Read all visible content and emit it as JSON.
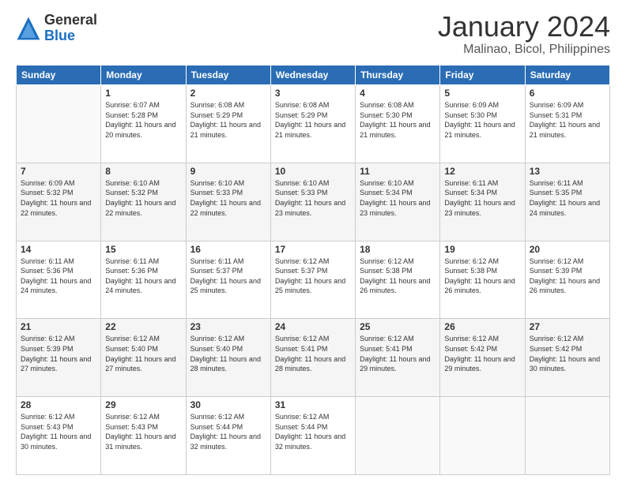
{
  "header": {
    "logo_general": "General",
    "logo_blue": "Blue",
    "month_title": "January 2024",
    "location": "Malinao, Bicol, Philippines"
  },
  "weekdays": [
    "Sunday",
    "Monday",
    "Tuesday",
    "Wednesday",
    "Thursday",
    "Friday",
    "Saturday"
  ],
  "weeks": [
    [
      {
        "day": "",
        "sunrise": "",
        "sunset": "",
        "daylight": ""
      },
      {
        "day": "1",
        "sunrise": "Sunrise: 6:07 AM",
        "sunset": "Sunset: 5:28 PM",
        "daylight": "Daylight: 11 hours and 20 minutes."
      },
      {
        "day": "2",
        "sunrise": "Sunrise: 6:08 AM",
        "sunset": "Sunset: 5:29 PM",
        "daylight": "Daylight: 11 hours and 21 minutes."
      },
      {
        "day": "3",
        "sunrise": "Sunrise: 6:08 AM",
        "sunset": "Sunset: 5:29 PM",
        "daylight": "Daylight: 11 hours and 21 minutes."
      },
      {
        "day": "4",
        "sunrise": "Sunrise: 6:08 AM",
        "sunset": "Sunset: 5:30 PM",
        "daylight": "Daylight: 11 hours and 21 minutes."
      },
      {
        "day": "5",
        "sunrise": "Sunrise: 6:09 AM",
        "sunset": "Sunset: 5:30 PM",
        "daylight": "Daylight: 11 hours and 21 minutes."
      },
      {
        "day": "6",
        "sunrise": "Sunrise: 6:09 AM",
        "sunset": "Sunset: 5:31 PM",
        "daylight": "Daylight: 11 hours and 21 minutes."
      }
    ],
    [
      {
        "day": "7",
        "sunrise": "Sunrise: 6:09 AM",
        "sunset": "Sunset: 5:32 PM",
        "daylight": "Daylight: 11 hours and 22 minutes."
      },
      {
        "day": "8",
        "sunrise": "Sunrise: 6:10 AM",
        "sunset": "Sunset: 5:32 PM",
        "daylight": "Daylight: 11 hours and 22 minutes."
      },
      {
        "day": "9",
        "sunrise": "Sunrise: 6:10 AM",
        "sunset": "Sunset: 5:33 PM",
        "daylight": "Daylight: 11 hours and 22 minutes."
      },
      {
        "day": "10",
        "sunrise": "Sunrise: 6:10 AM",
        "sunset": "Sunset: 5:33 PM",
        "daylight": "Daylight: 11 hours and 23 minutes."
      },
      {
        "day": "11",
        "sunrise": "Sunrise: 6:10 AM",
        "sunset": "Sunset: 5:34 PM",
        "daylight": "Daylight: 11 hours and 23 minutes."
      },
      {
        "day": "12",
        "sunrise": "Sunrise: 6:11 AM",
        "sunset": "Sunset: 5:34 PM",
        "daylight": "Daylight: 11 hours and 23 minutes."
      },
      {
        "day": "13",
        "sunrise": "Sunrise: 6:11 AM",
        "sunset": "Sunset: 5:35 PM",
        "daylight": "Daylight: 11 hours and 24 minutes."
      }
    ],
    [
      {
        "day": "14",
        "sunrise": "Sunrise: 6:11 AM",
        "sunset": "Sunset: 5:36 PM",
        "daylight": "Daylight: 11 hours and 24 minutes."
      },
      {
        "day": "15",
        "sunrise": "Sunrise: 6:11 AM",
        "sunset": "Sunset: 5:36 PM",
        "daylight": "Daylight: 11 hours and 24 minutes."
      },
      {
        "day": "16",
        "sunrise": "Sunrise: 6:11 AM",
        "sunset": "Sunset: 5:37 PM",
        "daylight": "Daylight: 11 hours and 25 minutes."
      },
      {
        "day": "17",
        "sunrise": "Sunrise: 6:12 AM",
        "sunset": "Sunset: 5:37 PM",
        "daylight": "Daylight: 11 hours and 25 minutes."
      },
      {
        "day": "18",
        "sunrise": "Sunrise: 6:12 AM",
        "sunset": "Sunset: 5:38 PM",
        "daylight": "Daylight: 11 hours and 26 minutes."
      },
      {
        "day": "19",
        "sunrise": "Sunrise: 6:12 AM",
        "sunset": "Sunset: 5:38 PM",
        "daylight": "Daylight: 11 hours and 26 minutes."
      },
      {
        "day": "20",
        "sunrise": "Sunrise: 6:12 AM",
        "sunset": "Sunset: 5:39 PM",
        "daylight": "Daylight: 11 hours and 26 minutes."
      }
    ],
    [
      {
        "day": "21",
        "sunrise": "Sunrise: 6:12 AM",
        "sunset": "Sunset: 5:39 PM",
        "daylight": "Daylight: 11 hours and 27 minutes."
      },
      {
        "day": "22",
        "sunrise": "Sunrise: 6:12 AM",
        "sunset": "Sunset: 5:40 PM",
        "daylight": "Daylight: 11 hours and 27 minutes."
      },
      {
        "day": "23",
        "sunrise": "Sunrise: 6:12 AM",
        "sunset": "Sunset: 5:40 PM",
        "daylight": "Daylight: 11 hours and 28 minutes."
      },
      {
        "day": "24",
        "sunrise": "Sunrise: 6:12 AM",
        "sunset": "Sunset: 5:41 PM",
        "daylight": "Daylight: 11 hours and 28 minutes."
      },
      {
        "day": "25",
        "sunrise": "Sunrise: 6:12 AM",
        "sunset": "Sunset: 5:41 PM",
        "daylight": "Daylight: 11 hours and 29 minutes."
      },
      {
        "day": "26",
        "sunrise": "Sunrise: 6:12 AM",
        "sunset": "Sunset: 5:42 PM",
        "daylight": "Daylight: 11 hours and 29 minutes."
      },
      {
        "day": "27",
        "sunrise": "Sunrise: 6:12 AM",
        "sunset": "Sunset: 5:42 PM",
        "daylight": "Daylight: 11 hours and 30 minutes."
      }
    ],
    [
      {
        "day": "28",
        "sunrise": "Sunrise: 6:12 AM",
        "sunset": "Sunset: 5:43 PM",
        "daylight": "Daylight: 11 hours and 30 minutes."
      },
      {
        "day": "29",
        "sunrise": "Sunrise: 6:12 AM",
        "sunset": "Sunset: 5:43 PM",
        "daylight": "Daylight: 11 hours and 31 minutes."
      },
      {
        "day": "30",
        "sunrise": "Sunrise: 6:12 AM",
        "sunset": "Sunset: 5:44 PM",
        "daylight": "Daylight: 11 hours and 32 minutes."
      },
      {
        "day": "31",
        "sunrise": "Sunrise: 6:12 AM",
        "sunset": "Sunset: 5:44 PM",
        "daylight": "Daylight: 11 hours and 32 minutes."
      },
      {
        "day": "",
        "sunrise": "",
        "sunset": "",
        "daylight": ""
      },
      {
        "day": "",
        "sunrise": "",
        "sunset": "",
        "daylight": ""
      },
      {
        "day": "",
        "sunrise": "",
        "sunset": "",
        "daylight": ""
      }
    ]
  ]
}
